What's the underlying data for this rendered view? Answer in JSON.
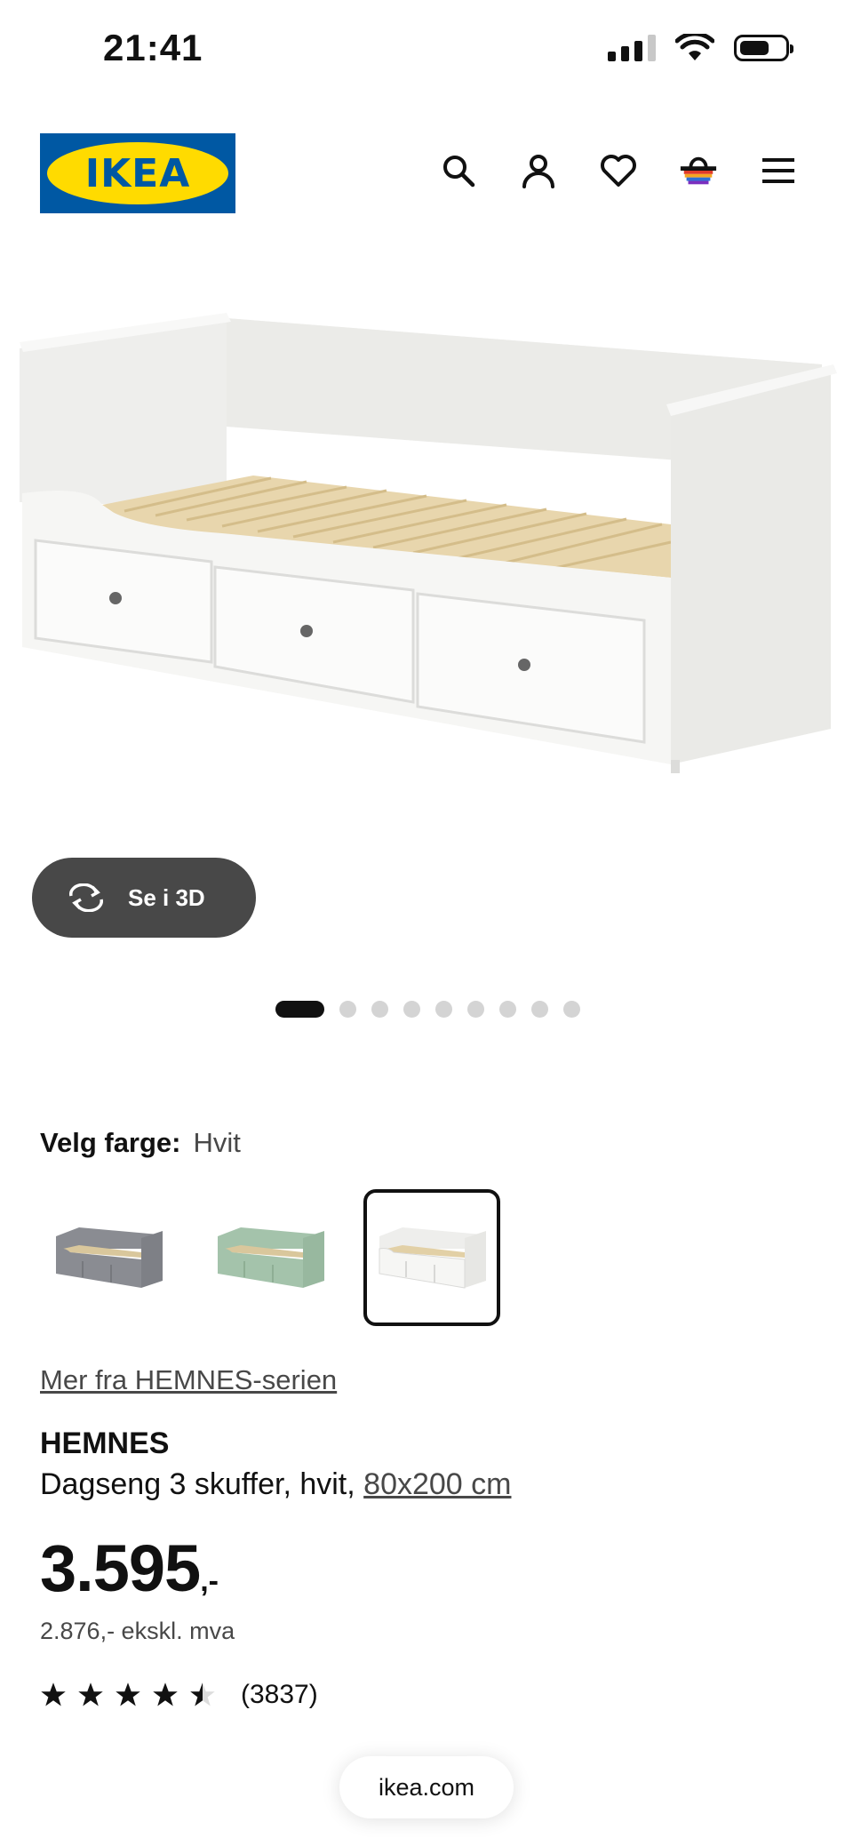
{
  "status": {
    "time": "21:41"
  },
  "header": {
    "logo_text": "IKEA",
    "icons": [
      "search-icon",
      "account-icon",
      "heart-icon",
      "basket-icon",
      "menu-icon"
    ]
  },
  "gallery": {
    "button_3d_label": "Se i 3D",
    "dot_count": 9,
    "active_index": 0
  },
  "color_picker": {
    "label": "Velg farge:",
    "value": "Hvit",
    "options": [
      {
        "name": "grey",
        "color": "#8a8c92",
        "selected": false
      },
      {
        "name": "green",
        "color": "#a4c3ab",
        "selected": false
      },
      {
        "name": "white",
        "color": "#f6f6f4",
        "selected": true
      }
    ]
  },
  "product": {
    "series_link": "Mer fra HEMNES-serien",
    "name": "HEMNES",
    "description": "Dagseng 3 skuffer, hvit,",
    "size": "80x200 cm",
    "price_integer": "3.595",
    "price_suffix": ",-",
    "price_ex_vat": "2.876,- ekskl. mva",
    "rating": 4.5,
    "rating_count": "(3837)"
  },
  "browser": {
    "url": "ikea.com"
  },
  "colors": {
    "brand_blue": "#0058a3",
    "brand_yellow": "#ffdb00",
    "dark_button": "#484848"
  }
}
